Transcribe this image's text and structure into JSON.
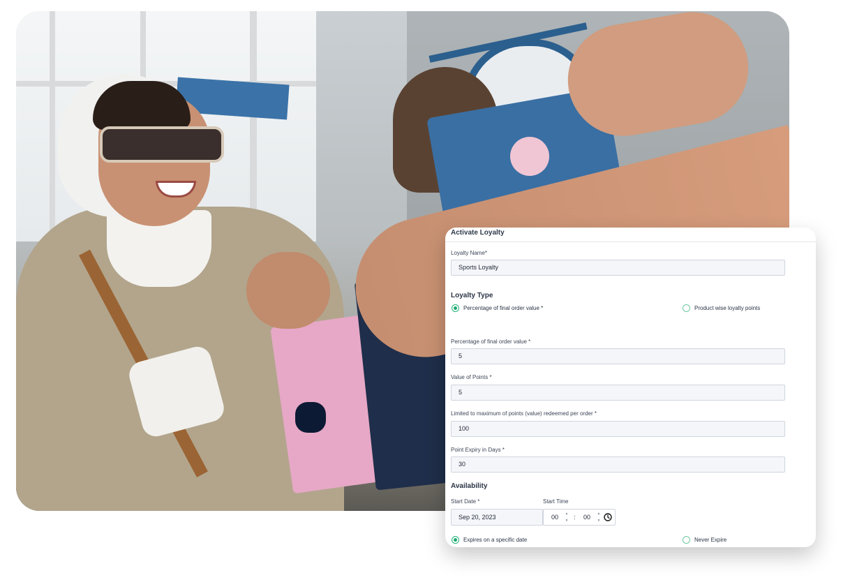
{
  "form": {
    "title": "Activate Loyalty",
    "loyalty_name_label": "Loyalty Name*",
    "loyalty_name_value": "Sports Loyalty",
    "loyalty_type_heading": "Loyalty Type",
    "loyalty_type_options": [
      {
        "label": "Percentage of final order value *",
        "selected": true
      },
      {
        "label": "Product wise loyalty points",
        "selected": false
      }
    ],
    "percentage_label": "Percentage of final order value *",
    "percentage_value": "5",
    "value_of_points_label": "Value of Points *",
    "value_of_points_value": "5",
    "max_points_label": "Limited to maximum of points (value) redeemed per order *",
    "max_points_value": "100",
    "expiry_label": "Point Expiry in Days *",
    "expiry_value": "30",
    "availability_heading": "Availability",
    "start_date_label": "Start Date *",
    "start_date_value": "Sep 20, 2023",
    "start_time_label": "Start Time",
    "start_time_hours": "00",
    "start_time_separator": ":",
    "start_time_minutes": "00",
    "expiry_options": [
      {
        "label": "Expires on a specific date",
        "selected": true
      },
      {
        "label": "Never Expire",
        "selected": false
      }
    ]
  },
  "colors": {
    "accent_green": "#1aa86e",
    "field_background": "#f5f6fa",
    "field_border": "#cfd4dd"
  },
  "icons": {
    "time_picker_icon": "clock-icon",
    "spinner_up": "caret-up-icon",
    "spinner_down": "caret-down-icon"
  }
}
